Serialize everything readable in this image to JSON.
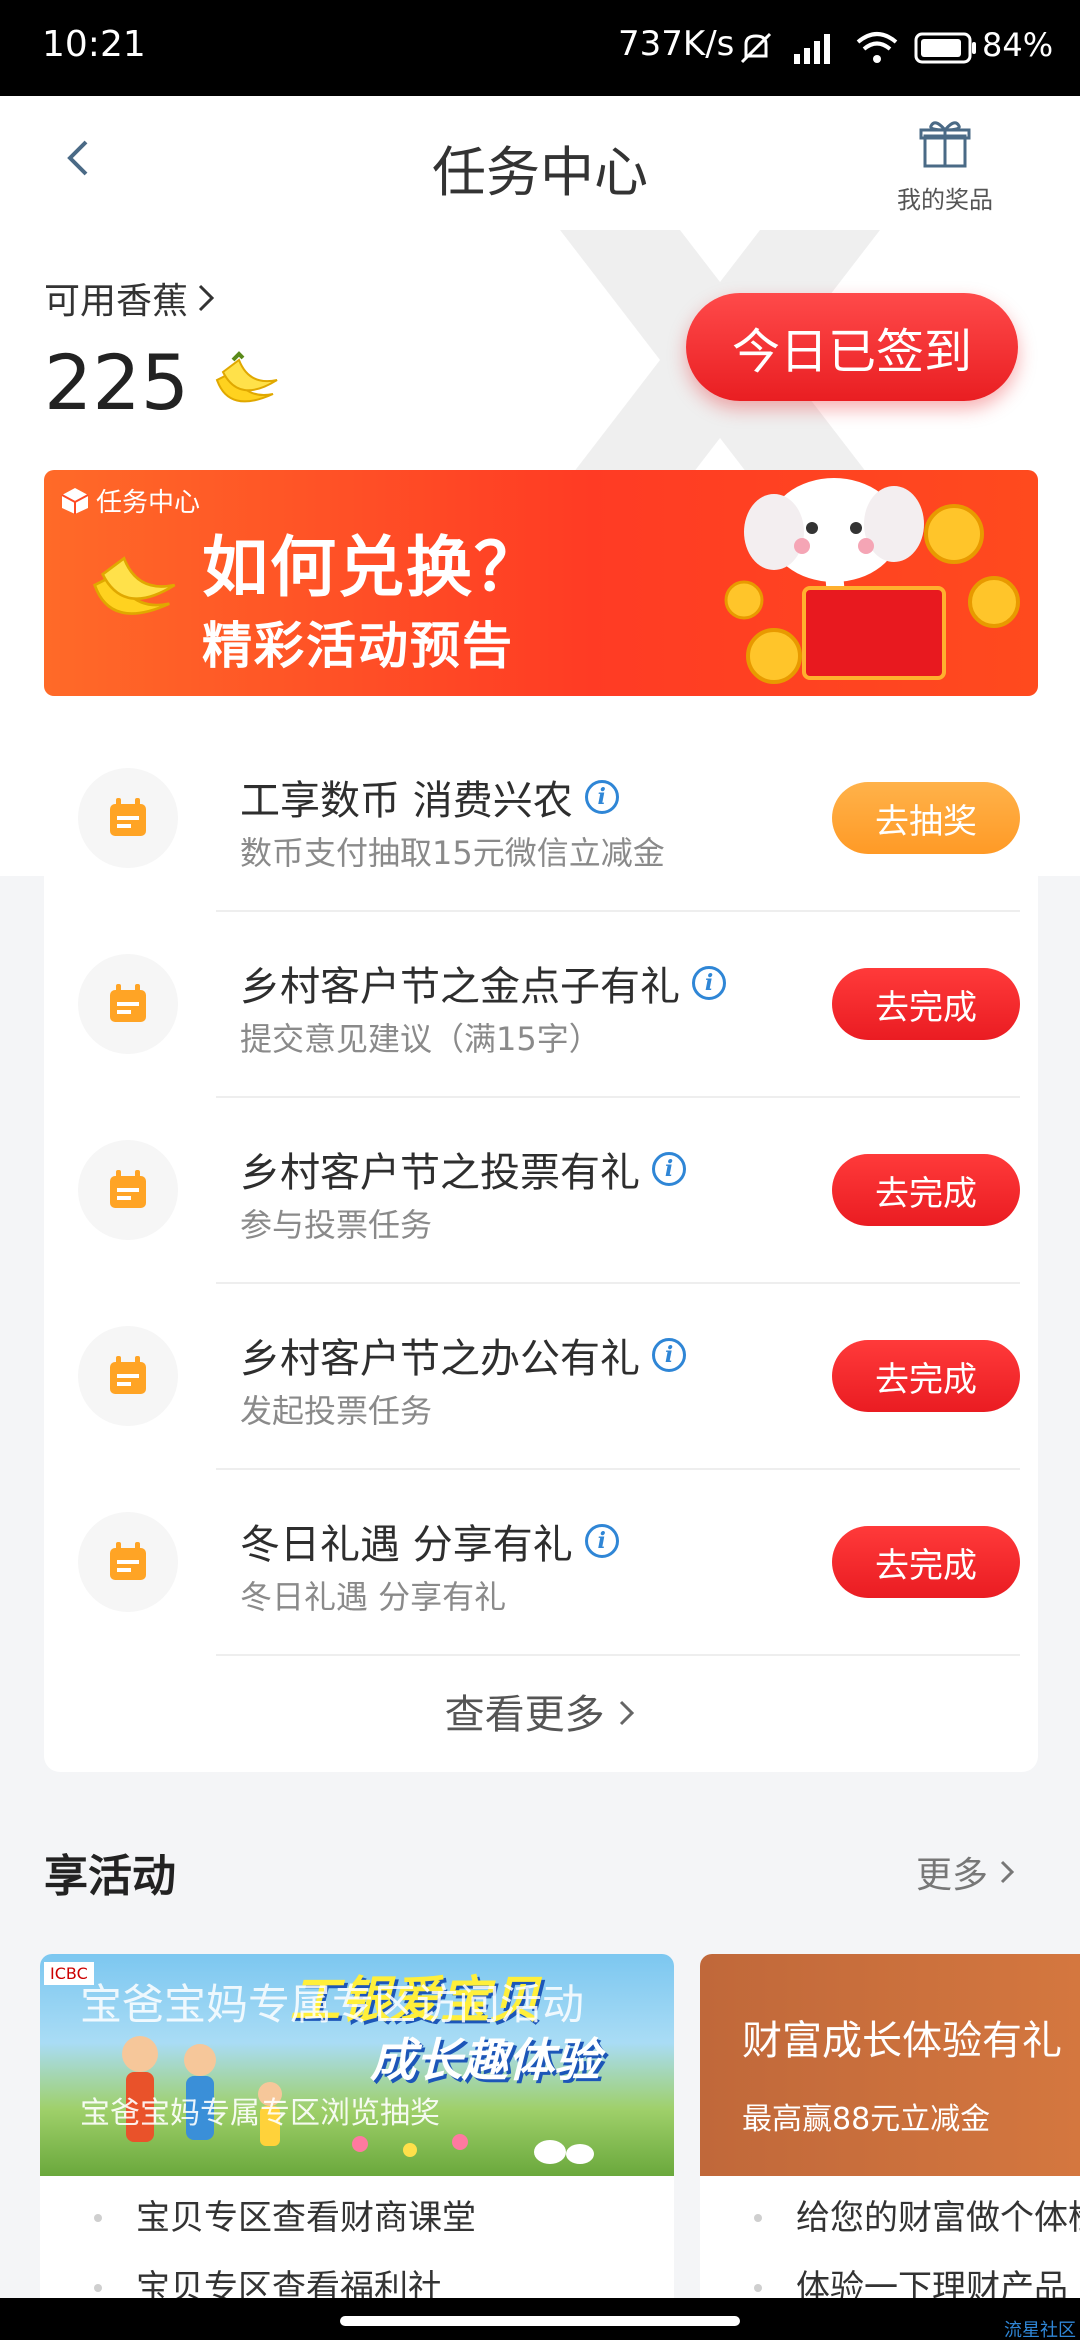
{
  "status_bar": {
    "time": "10:21",
    "net_speed": "737K/s",
    "battery": "84%"
  },
  "header": {
    "title": "任务中心",
    "prize_label": "我的奖品"
  },
  "balance": {
    "label": "可用香蕉",
    "value": "225",
    "sign_button": "今日已签到"
  },
  "banner": {
    "badge": "任务中心",
    "line1": "如何兑换？",
    "line2": "精彩活动预告"
  },
  "tasks": [
    {
      "title": "工享数币 消费兴农",
      "subtitle": "数币支付抽取15元微信立减金",
      "button": "去抽奖"
    },
    {
      "title": "乡村客户节之金点子有礼",
      "subtitle": "提交意见建议（满15字）",
      "button": "去完成"
    },
    {
      "title": "乡村客户节之投票有礼",
      "subtitle": "参与投票任务",
      "button": "去完成"
    },
    {
      "title": "乡村客户节之办公有礼",
      "subtitle": "发起投票任务",
      "button": "去完成"
    },
    {
      "title": "冬日礼遇 分享有礼",
      "subtitle": "冬日礼遇 分享有礼",
      "button": "去完成"
    }
  ],
  "view_more": "查看更多",
  "activities": {
    "title": "享活动",
    "more": "更多",
    "cards": [
      {
        "brand": "ICBC",
        "art_line1": "工银爱宝贝",
        "art_line2": "成长趣体验",
        "overlay_title": "宝爸宝妈专属专区访问活动",
        "overlay_subtitle": "宝爸宝妈专属专区浏览抽奖",
        "items": [
          "宝贝专区查看财商课堂",
          "宝贝专区查看福利社"
        ]
      },
      {
        "title": "财富成长体验有礼",
        "subtitle": "最高赢88元立减金",
        "items": [
          "给您的财富做个体检",
          "体验一下理财产品"
        ]
      }
    ]
  },
  "watermark_tag": "流星社区"
}
